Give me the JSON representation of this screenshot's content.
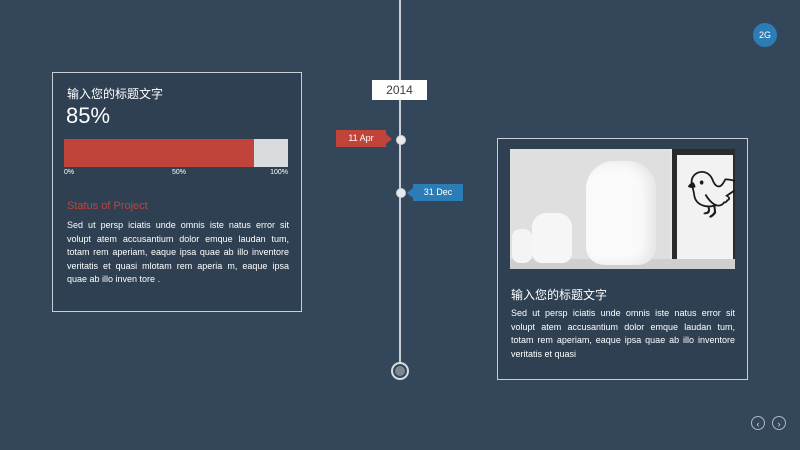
{
  "page": {
    "number": "2G"
  },
  "timeline": {
    "year": "2014",
    "events": [
      {
        "label": "11 Apr",
        "color": "#c0443a"
      },
      {
        "label": "31 Dec",
        "color": "#2c7db6"
      }
    ]
  },
  "left_card": {
    "title": "输入您的标题文字",
    "percent_text": "85%",
    "progress": {
      "value": 0.85,
      "fill_color": "#c0443a",
      "track_color": "#d9dcdf"
    },
    "scale": [
      "0%",
      "50%",
      "100%"
    ],
    "status_title": "Status of Project",
    "body": "Sed ut persp iciatis unde omnis iste natus error sit volupt atem accusantium dolor emque laudan tum, totam rem aperiam, eaque ipsa quae ab illo inventore veritatis et quasi mlotam rem aperia m, eaque ipsa quae ab illo inven tore ."
  },
  "right_card": {
    "image": "white-vases-and-crow-photo",
    "title": "输入您的标题文字",
    "body": "Sed ut persp iciatis unde omnis iste natus error sit volupt atem accusantium dolor emque laudan tum, totam rem aperiam, eaque ipsa quae ab illo inventore veritatis et quasi"
  },
  "nav": {
    "prev_icon": "chevron-left-icon",
    "next_icon": "chevron-right-icon"
  },
  "colors": {
    "background": "#34475a",
    "accent_red": "#c0443a",
    "accent_blue": "#2c7db6"
  }
}
